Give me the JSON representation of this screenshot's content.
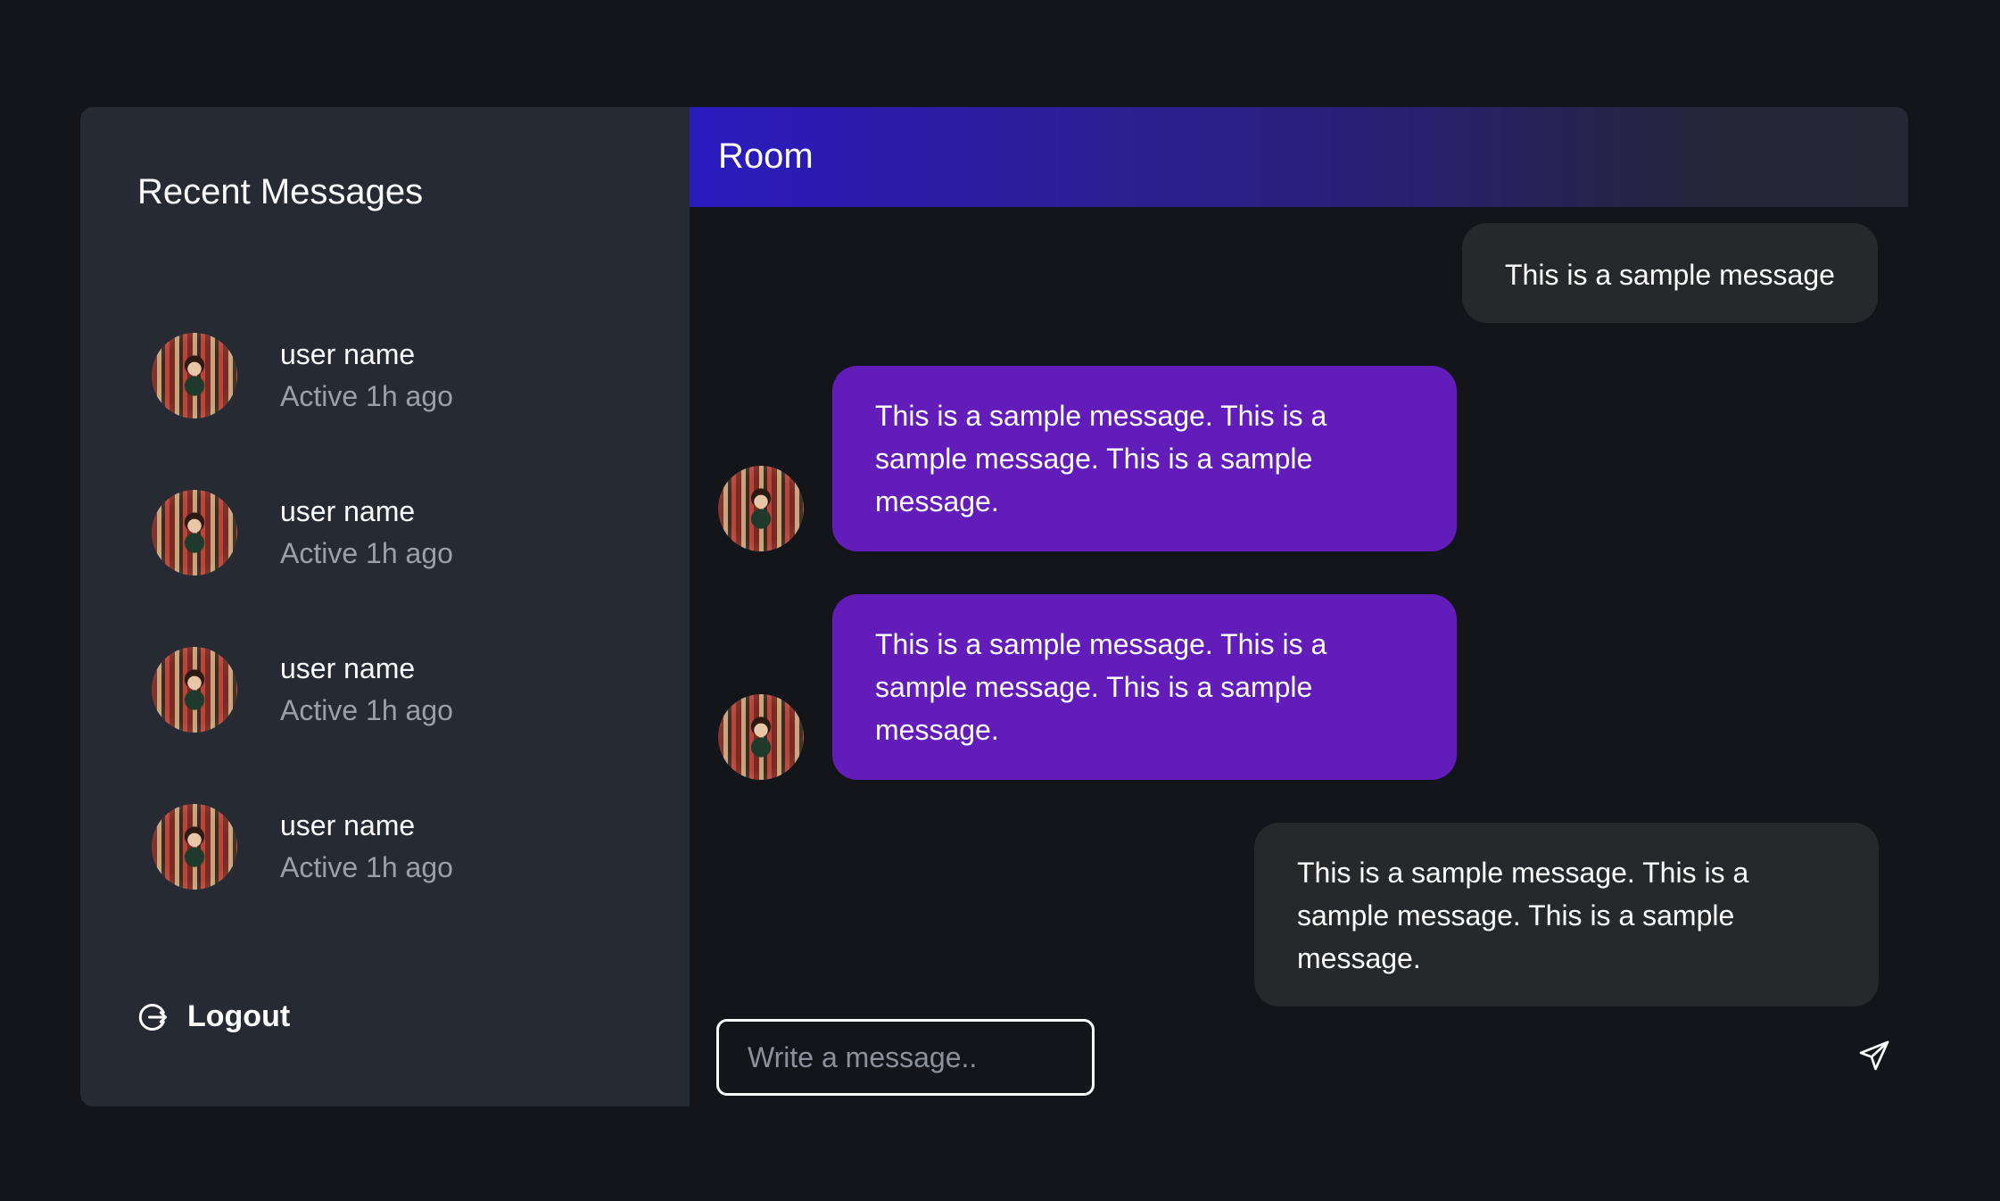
{
  "sidebar": {
    "title": "Recent Messages",
    "contacts": [
      {
        "name": "user name",
        "status": "Active 1h ago"
      },
      {
        "name": "user name",
        "status": "Active 1h ago"
      },
      {
        "name": "user name",
        "status": "Active 1h ago"
      },
      {
        "name": "user name",
        "status": "Active 1h ago"
      }
    ],
    "logout_label": "Logout",
    "logout_icon": "logout-icon"
  },
  "chat": {
    "room_title": "Room",
    "messages": [
      {
        "direction": "outgoing",
        "text": "This is a sample message"
      },
      {
        "direction": "incoming",
        "text": "This is a sample message. This is a sample message. This is a sample message."
      },
      {
        "direction": "incoming",
        "text": "This is a sample message. This is a sample message. This is a sample message."
      },
      {
        "direction": "outgoing",
        "text": "This is a sample message. This is a sample message. This is a sample message."
      }
    ],
    "composer": {
      "placeholder": "Write a message..",
      "value": ""
    },
    "send_icon": "send-icon"
  },
  "colors": {
    "background": "#13151a",
    "sidebar": "#252a33",
    "outgoing_bubble": "#27282b",
    "incoming_bubble": "#621cba",
    "header_gradient_start": "#2a1bbd",
    "header_gradient_end": "#262835",
    "muted_text": "#9aa0ab"
  }
}
